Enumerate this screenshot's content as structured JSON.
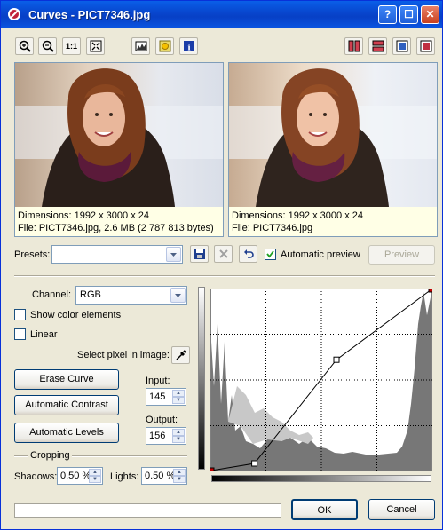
{
  "window": {
    "title": "Curves - PICT7346.jpg"
  },
  "titlebar_buttons": {
    "help": "?",
    "maximize": "☐",
    "close": "✕"
  },
  "toolbar": {
    "zoom_in": "zoom-in-icon",
    "zoom_out": "zoom-out-icon",
    "actual_size": "1:1",
    "fit": "fit-window-icon"
  },
  "preview": {
    "left": {
      "dimensions": "Dimensions: 1992 x 3000 x 24",
      "file": "File: PICT7346.jpg, 2.6 MB (2 787 813 bytes)"
    },
    "right": {
      "dimensions": "Dimensions: 1992 x 3000 x 24",
      "file": "File: PICT7346.jpg"
    }
  },
  "presets": {
    "label": "Presets:",
    "value": "",
    "automatic_preview_label": "Automatic preview",
    "automatic_preview_checked": true,
    "preview_button": "Preview"
  },
  "controls": {
    "channel_label": "Channel:",
    "channel_value": "RGB",
    "show_color_elements": "Show color elements",
    "linear": "Linear",
    "select_pixel": "Select pixel in image:",
    "erase_curve": "Erase Curve",
    "automatic_contrast": "Automatic Contrast",
    "automatic_levels": "Automatic Levels",
    "input_label": "Input:",
    "input_value": "145",
    "output_label": "Output:",
    "output_value": "156",
    "cropping_label": "Cropping",
    "shadows_label": "Shadows:",
    "shadows_value": "0.50 %",
    "lights_label": "Lights:",
    "lights_value": "0.50 %"
  },
  "curve": {
    "points": [
      [
        0,
        0
      ],
      [
        50,
        10
      ],
      [
        145,
        156
      ],
      [
        255,
        255
      ]
    ]
  },
  "footer": {
    "ok": "OK",
    "cancel": "Cancel"
  }
}
